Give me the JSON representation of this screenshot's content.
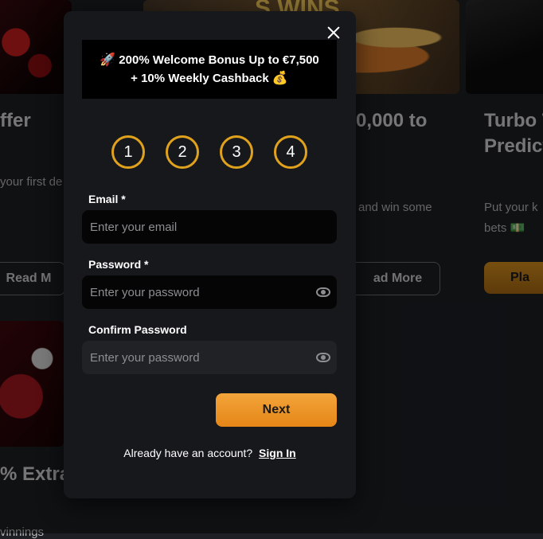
{
  "background": {
    "card1_title": "ffer",
    "card1_text": "your first de",
    "card1_button": "Read M",
    "card2_title": "0,000 to",
    "card2_text": "and win some",
    "card2_button": "ad More",
    "card3_title_line1": "Turbo T",
    "card3_title_line2": "Predict",
    "card3_text_line1": "Put your k",
    "card3_text_line2": "bets 💵",
    "card3_button": "Pla",
    "card4_title": "% Extra",
    "card4_text": "vinnings",
    "card2_image_text": "S WINS"
  },
  "modal": {
    "banner_line1": "200% Welcome Bonus Up to €7,500",
    "banner_line2": "+ 10% Weekly Cashback",
    "banner_emoji1": "🚀",
    "banner_emoji2": "💰",
    "steps": [
      "1",
      "2",
      "3",
      "4"
    ],
    "email_label": "Email *",
    "email_placeholder": "Enter your email",
    "password_label": "Password *",
    "password_placeholder": "Enter your password",
    "confirm_label": "Confirm Password",
    "confirm_placeholder": "Enter your password",
    "next_label": "Next",
    "account_prompt": "Already have an account?",
    "signin_label": "Sign In"
  },
  "colors": {
    "accent": "#e58617",
    "step_ring": "#e0a21c"
  }
}
